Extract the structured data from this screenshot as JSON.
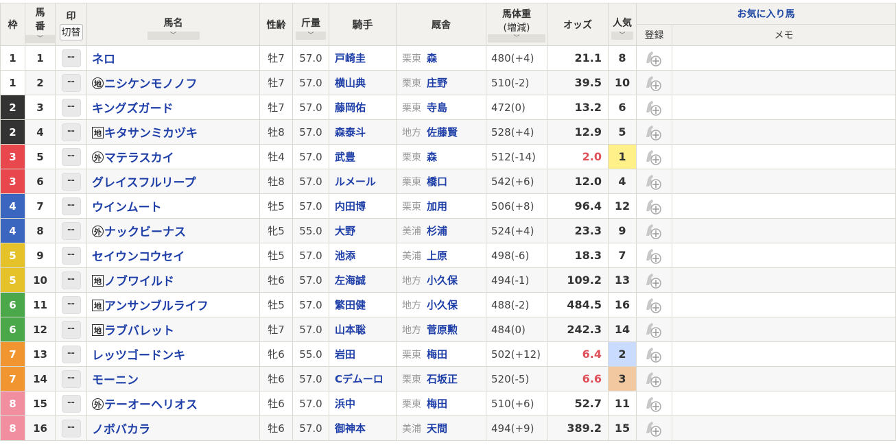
{
  "header": {
    "waku": "枠",
    "umaban_1": "馬",
    "umaban_2": "番",
    "mark": "印",
    "mark_toggle": "切替",
    "name": "馬名",
    "sexage": "性齢",
    "weight": "斤量",
    "jockey": "騎手",
    "stable": "厩舎",
    "body_1": "馬体重",
    "body_2": "(増減)",
    "odds": "オッズ",
    "popular": "人気",
    "favorite": "お気に入り馬",
    "register": "登録",
    "memo": "メモ",
    "sort_glyph": "﹀"
  },
  "mark_placeholder": "--",
  "colors": {
    "1": "#ffffff",
    "2": "#333333",
    "3": "#e8474e",
    "4": "#3b66bf",
    "5": "#e6c22a",
    "6": "#4aa74a",
    "7": "#f0952f",
    "8": "#f18fa0",
    "pop1": "#fff08a",
    "pop2": "#c9dcff",
    "pop3": "#f2c8a0"
  },
  "rows": [
    {
      "waku": "1",
      "num": "1",
      "pre": "",
      "name": "ネロ",
      "sex": "牡7",
      "kg": "57.0",
      "jockey": "戸崎圭",
      "region": "栗東",
      "trainer": "森",
      "body": "480(+4)",
      "odds": "21.1",
      "pop": "8"
    },
    {
      "waku": "1",
      "num": "2",
      "pre": "地",
      "pretype": "circ",
      "name": "ニシケンモノノフ",
      "sex": "牡7",
      "kg": "57.0",
      "jockey": "横山典",
      "region": "栗東",
      "trainer": "庄野",
      "body": "510(-2)",
      "odds": "39.5",
      "pop": "10"
    },
    {
      "waku": "2",
      "num": "3",
      "pre": "",
      "name": "キングズガード",
      "sex": "牡7",
      "kg": "57.0",
      "jockey": "藤岡佑",
      "region": "栗東",
      "trainer": "寺島",
      "body": "472(0)",
      "odds": "13.2",
      "pop": "6"
    },
    {
      "waku": "2",
      "num": "4",
      "pre": "地",
      "pretype": "box",
      "name": "キタサンミカヅキ",
      "sex": "牡8",
      "kg": "57.0",
      "jockey": "森泰斗",
      "region": "地方",
      "trainer": "佐藤賢",
      "body": "528(+4)",
      "odds": "12.9",
      "pop": "5"
    },
    {
      "waku": "3",
      "num": "5",
      "pre": "外",
      "pretype": "circ",
      "name": "マテラスカイ",
      "sex": "牡4",
      "kg": "57.0",
      "jockey": "武豊",
      "region": "栗東",
      "trainer": "森",
      "body": "512(-14)",
      "odds": "2.0",
      "pop": "1"
    },
    {
      "waku": "3",
      "num": "6",
      "pre": "",
      "name": "グレイスフルリープ",
      "sex": "牡8",
      "kg": "57.0",
      "jockey": "ルメール",
      "region": "栗東",
      "trainer": "橋口",
      "body": "542(+6)",
      "odds": "12.0",
      "pop": "4"
    },
    {
      "waku": "4",
      "num": "7",
      "pre": "",
      "name": "ウインムート",
      "sex": "牡5",
      "kg": "57.0",
      "jockey": "内田博",
      "region": "栗東",
      "trainer": "加用",
      "body": "506(+8)",
      "odds": "96.4",
      "pop": "12"
    },
    {
      "waku": "4",
      "num": "8",
      "pre": "外",
      "pretype": "circ",
      "name": "ナックビーナス",
      "sex": "牝5",
      "kg": "55.0",
      "jockey": "大野",
      "region": "美浦",
      "trainer": "杉浦",
      "body": "524(+4)",
      "odds": "23.3",
      "pop": "9"
    },
    {
      "waku": "5",
      "num": "9",
      "pre": "",
      "name": "セイウンコウセイ",
      "sex": "牡5",
      "kg": "57.0",
      "jockey": "池添",
      "region": "美浦",
      "trainer": "上原",
      "body": "498(-6)",
      "odds": "18.3",
      "pop": "7"
    },
    {
      "waku": "5",
      "num": "10",
      "pre": "地",
      "pretype": "box",
      "name": "ノブワイルド",
      "sex": "牡6",
      "kg": "57.0",
      "jockey": "左海誠",
      "region": "地方",
      "trainer": "小久保",
      "body": "494(-1)",
      "odds": "109.2",
      "pop": "13"
    },
    {
      "waku": "6",
      "num": "11",
      "pre": "地",
      "pretype": "box",
      "name": "アンサンブルライフ",
      "sex": "牡5",
      "kg": "57.0",
      "jockey": "繁田健",
      "region": "地方",
      "trainer": "小久保",
      "body": "488(-2)",
      "odds": "484.5",
      "pop": "16"
    },
    {
      "waku": "6",
      "num": "12",
      "pre": "地",
      "pretype": "box",
      "name": "ラブバレット",
      "sex": "牡7",
      "kg": "57.0",
      "jockey": "山本聡",
      "region": "地方",
      "trainer": "菅原勲",
      "body": "484(0)",
      "odds": "242.3",
      "pop": "14"
    },
    {
      "waku": "7",
      "num": "13",
      "pre": "",
      "name": "レッツゴードンキ",
      "sex": "牝6",
      "kg": "55.0",
      "jockey": "岩田",
      "region": "栗東",
      "trainer": "梅田",
      "body": "502(+12)",
      "odds": "6.4",
      "pop": "2"
    },
    {
      "waku": "7",
      "num": "14",
      "pre": "",
      "name": "モーニン",
      "sex": "牡6",
      "kg": "57.0",
      "jockey": "Cデムーロ",
      "region": "栗東",
      "trainer": "石坂正",
      "body": "520(-5)",
      "odds": "6.6",
      "pop": "3"
    },
    {
      "waku": "8",
      "num": "15",
      "pre": "外",
      "pretype": "circ",
      "name": "テーオーヘリオス",
      "sex": "牡6",
      "kg": "57.0",
      "jockey": "浜中",
      "region": "栗東",
      "trainer": "梅田",
      "body": "510(+6)",
      "odds": "52.7",
      "pop": "11"
    },
    {
      "waku": "8",
      "num": "16",
      "pre": "",
      "name": "ノボバカラ",
      "sex": "牡6",
      "kg": "57.0",
      "jockey": "御神本",
      "region": "美浦",
      "trainer": "天間",
      "body": "494(+9)",
      "odds": "389.2",
      "pop": "15"
    }
  ]
}
